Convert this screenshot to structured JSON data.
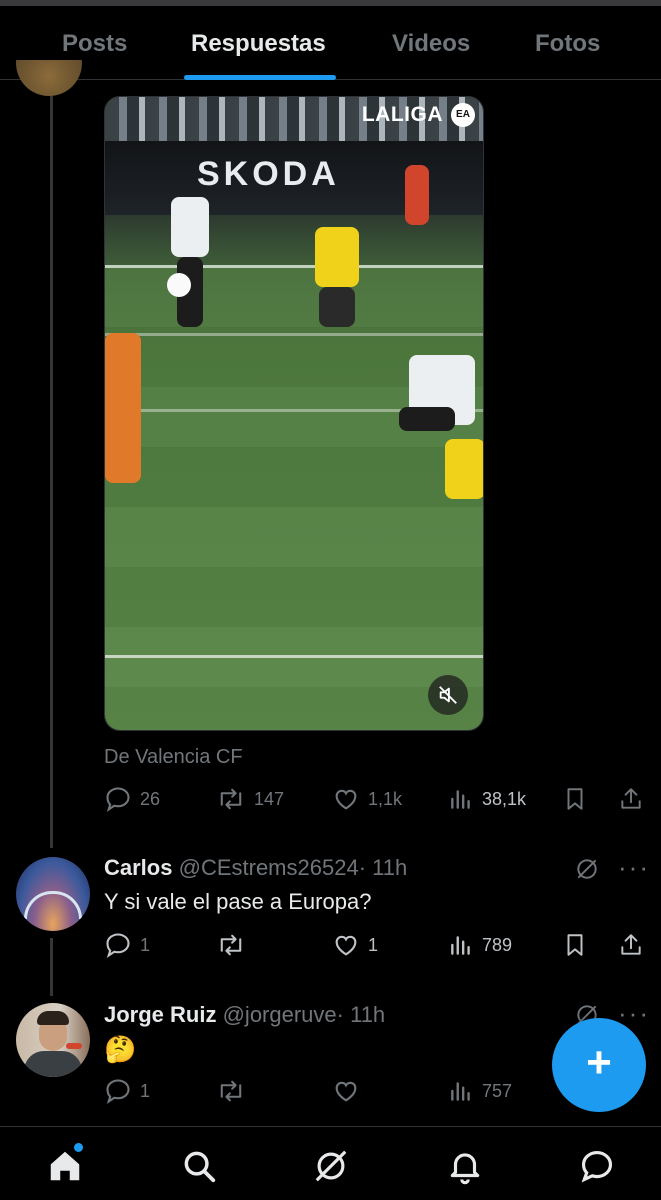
{
  "tabs": [
    {
      "label": "Posts"
    },
    {
      "label": "Respuestas"
    },
    {
      "label": "Videos"
    },
    {
      "label": "Fotos"
    }
  ],
  "active_tab": "Respuestas",
  "video": {
    "brand_overlay": "LALIGA",
    "board_text": "SKODA",
    "muted": true
  },
  "post1": {
    "source": "De Valencia CF",
    "stats": {
      "replies": "26",
      "reposts": "147",
      "likes": "1,1k",
      "views": "38,1k"
    }
  },
  "post2": {
    "name": "Carlos",
    "handle": "@CEstrems26524",
    "time": "· 11h",
    "text": "Y si vale el pase a Europa?",
    "stats": {
      "replies": "1",
      "reposts": "",
      "likes": "1",
      "views": "789"
    }
  },
  "post3": {
    "name": "Jorge Ruiz",
    "handle": "@jorgeruve",
    "time": "· 11h",
    "text": "🤔",
    "stats": {
      "replies": "1",
      "reposts": "",
      "likes": "",
      "views": "757"
    }
  },
  "fab": {
    "label": "+"
  },
  "colors": {
    "background": "#000000",
    "accent": "#1d9bf0",
    "text_primary": "#e7e9ea",
    "text_secondary": "#71767b",
    "divider": "#2f3336"
  },
  "icons": [
    "reply-icon",
    "repost-icon",
    "like-icon",
    "views-icon",
    "bookmark-icon",
    "share-icon",
    "grok-icon",
    "more-icon",
    "home-icon",
    "search-icon",
    "bell-icon",
    "messages-icon",
    "mute-icon"
  ]
}
